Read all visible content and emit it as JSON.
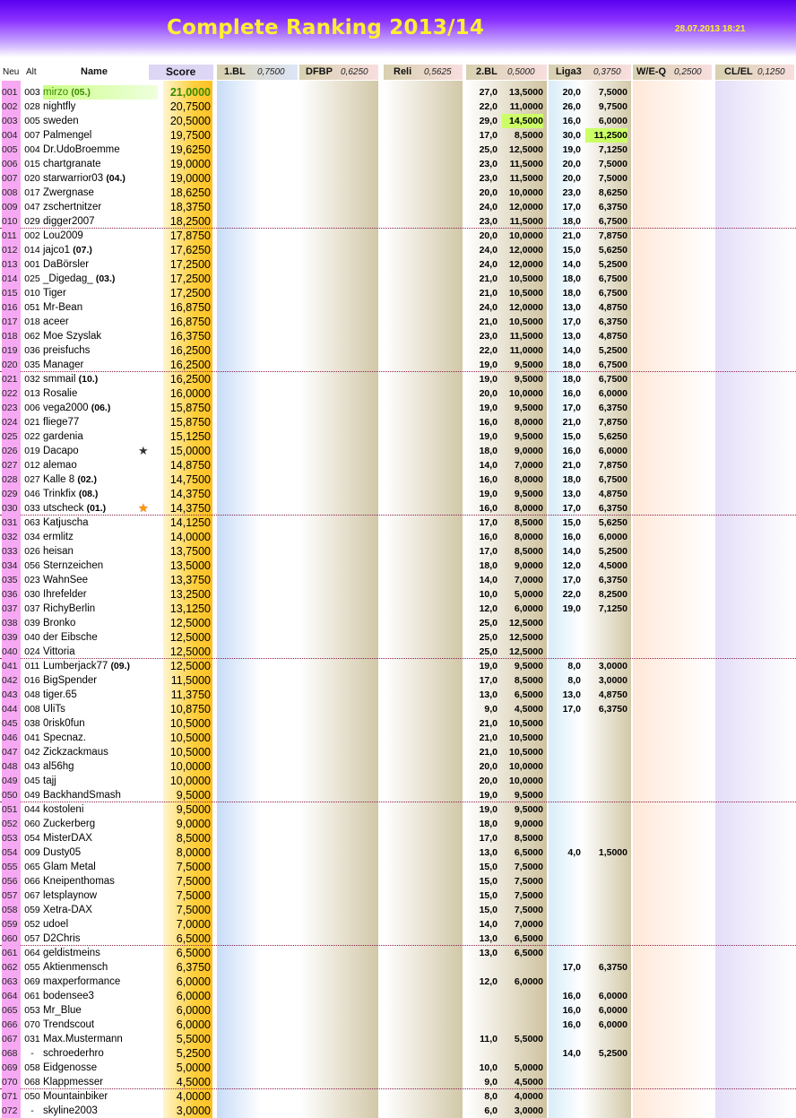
{
  "header": {
    "title": "Complete Ranking 2013/14",
    "timestamp": "28.07.2013 18:21"
  },
  "columns": {
    "neu": "Neu",
    "alt": "Alt",
    "name": "Name",
    "score": "Score",
    "comps": [
      {
        "label": "1.BL",
        "weight": "0,7500",
        "bg": "#dde6f8"
      },
      {
        "label": "DFBP",
        "weight": "0,6250",
        "bg": "#f8dede"
      },
      {
        "label": "Reli",
        "weight": "0,5625",
        "bg": "#f8dede"
      },
      {
        "label": "2.BL",
        "weight": "0,5000",
        "bg": "#f8dede"
      },
      {
        "label": "Liga3",
        "weight": "0,3750",
        "bg": "#f8dede"
      },
      {
        "label": "W/E-Q",
        "weight": "0,2500",
        "bg": "#f8dede"
      },
      {
        "label": "CL/EL",
        "weight": "0,1250",
        "bg": "#f8dede"
      }
    ]
  },
  "colors": {
    "neu": "#f6a8f2",
    "score": "#ffcc33",
    "highlight": "#ccff66",
    "title": "#ffee33",
    "banner": "#6a10f8"
  },
  "rows": [
    {
      "neu": "001",
      "alt": "003",
      "name": "mirzo",
      "badge": "(05.)",
      "score": "21,0000",
      "b2t": "27,0",
      "b2s": "13,5000",
      "l3t": "20,0",
      "l3s": "7,5000",
      "top": true
    },
    {
      "neu": "002",
      "alt": "028",
      "name": "nightfly",
      "badge": "",
      "score": "20,7500",
      "b2t": "22,0",
      "b2s": "11,0000",
      "l3t": "26,0",
      "l3s": "9,7500"
    },
    {
      "neu": "003",
      "alt": "005",
      "name": "sweden",
      "badge": "",
      "score": "20,5000",
      "b2t": "29,0",
      "b2s": "14,5000",
      "l3t": "16,0",
      "l3s": "6,0000",
      "hl2": true
    },
    {
      "neu": "004",
      "alt": "007",
      "name": "Palmengel",
      "badge": "",
      "score": "19,7500",
      "b2t": "17,0",
      "b2s": "8,5000",
      "l3t": "30,0",
      "l3s": "11,2500",
      "hl3": true
    },
    {
      "neu": "005",
      "alt": "004",
      "name": "Dr.UdoBroemme",
      "badge": "",
      "score": "19,6250",
      "b2t": "25,0",
      "b2s": "12,5000",
      "l3t": "19,0",
      "l3s": "7,1250"
    },
    {
      "neu": "006",
      "alt": "015",
      "name": "chartgranate",
      "badge": "",
      "score": "19,0000",
      "b2t": "23,0",
      "b2s": "11,5000",
      "l3t": "20,0",
      "l3s": "7,5000"
    },
    {
      "neu": "007",
      "alt": "020",
      "name": "starwarrior03",
      "badge": "(04.)",
      "score": "19,0000",
      "b2t": "23,0",
      "b2s": "11,5000",
      "l3t": "20,0",
      "l3s": "7,5000"
    },
    {
      "neu": "008",
      "alt": "017",
      "name": "Zwergnase",
      "badge": "",
      "score": "18,6250",
      "b2t": "20,0",
      "b2s": "10,0000",
      "l3t": "23,0",
      "l3s": "8,6250"
    },
    {
      "neu": "009",
      "alt": "047",
      "name": "zschertnitzer",
      "badge": "",
      "score": "18,3750",
      "b2t": "24,0",
      "b2s": "12,0000",
      "l3t": "17,0",
      "l3s": "6,3750"
    },
    {
      "neu": "010",
      "alt": "029",
      "name": "digger2007",
      "badge": "",
      "score": "18,2500",
      "b2t": "23,0",
      "b2s": "11,5000",
      "l3t": "18,0",
      "l3s": "6,7500"
    },
    {
      "neu": "011",
      "alt": "002",
      "name": "Lou2009",
      "badge": "",
      "score": "17,8750",
      "b2t": "20,0",
      "b2s": "10,0000",
      "l3t": "21,0",
      "l3s": "7,8750"
    },
    {
      "neu": "012",
      "alt": "014",
      "name": "jajco1",
      "badge": "(07.)",
      "score": "17,6250",
      "b2t": "24,0",
      "b2s": "12,0000",
      "l3t": "15,0",
      "l3s": "5,6250"
    },
    {
      "neu": "013",
      "alt": "001",
      "name": "DaBörsler",
      "badge": "",
      "score": "17,2500",
      "b2t": "24,0",
      "b2s": "12,0000",
      "l3t": "14,0",
      "l3s": "5,2500"
    },
    {
      "neu": "014",
      "alt": "025",
      "name": "_Digedag_",
      "badge": "(03.)",
      "score": "17,2500",
      "b2t": "21,0",
      "b2s": "10,5000",
      "l3t": "18,0",
      "l3s": "6,7500"
    },
    {
      "neu": "015",
      "alt": "010",
      "name": "Tiger",
      "badge": "",
      "score": "17,2500",
      "b2t": "21,0",
      "b2s": "10,5000",
      "l3t": "18,0",
      "l3s": "6,7500"
    },
    {
      "neu": "016",
      "alt": "051",
      "name": "Mr-Bean",
      "badge": "",
      "score": "16,8750",
      "b2t": "24,0",
      "b2s": "12,0000",
      "l3t": "13,0",
      "l3s": "4,8750"
    },
    {
      "neu": "017",
      "alt": "018",
      "name": "aceer",
      "badge": "",
      "score": "16,8750",
      "b2t": "21,0",
      "b2s": "10,5000",
      "l3t": "17,0",
      "l3s": "6,3750"
    },
    {
      "neu": "018",
      "alt": "062",
      "name": "Moe Szyslak",
      "badge": "",
      "score": "16,3750",
      "b2t": "23,0",
      "b2s": "11,5000",
      "l3t": "13,0",
      "l3s": "4,8750"
    },
    {
      "neu": "019",
      "alt": "036",
      "name": "preisfuchs",
      "badge": "",
      "score": "16,2500",
      "b2t": "22,0",
      "b2s": "11,0000",
      "l3t": "14,0",
      "l3s": "5,2500"
    },
    {
      "neu": "020",
      "alt": "035",
      "name": "Manager",
      "badge": "",
      "score": "16,2500",
      "b2t": "19,0",
      "b2s": "9,5000",
      "l3t": "18,0",
      "l3s": "6,7500"
    },
    {
      "neu": "021",
      "alt": "032",
      "name": "smmail",
      "badge": "(10.)",
      "score": "16,2500",
      "b2t": "19,0",
      "b2s": "9,5000",
      "l3t": "18,0",
      "l3s": "6,7500"
    },
    {
      "neu": "022",
      "alt": "013",
      "name": "Rosalie",
      "badge": "",
      "score": "16,0000",
      "b2t": "20,0",
      "b2s": "10,0000",
      "l3t": "16,0",
      "l3s": "6,0000"
    },
    {
      "neu": "023",
      "alt": "006",
      "name": "vega2000",
      "badge": "(06.)",
      "score": "15,8750",
      "b2t": "19,0",
      "b2s": "9,5000",
      "l3t": "17,0",
      "l3s": "6,3750"
    },
    {
      "neu": "024",
      "alt": "021",
      "name": "fliege77",
      "badge": "",
      "score": "15,8750",
      "b2t": "16,0",
      "b2s": "8,0000",
      "l3t": "21,0",
      "l3s": "7,8750"
    },
    {
      "neu": "025",
      "alt": "022",
      "name": "gardenia",
      "badge": "",
      "score": "15,1250",
      "b2t": "19,0",
      "b2s": "9,5000",
      "l3t": "15,0",
      "l3s": "5,6250"
    },
    {
      "neu": "026",
      "alt": "019",
      "name": "Dacapo",
      "badge": "",
      "score": "15,0000",
      "b2t": "18,0",
      "b2s": "9,0000",
      "l3t": "16,0",
      "l3s": "6,0000",
      "star": "dark"
    },
    {
      "neu": "027",
      "alt": "012",
      "name": "alemao",
      "badge": "",
      "score": "14,8750",
      "b2t": "14,0",
      "b2s": "7,0000",
      "l3t": "21,0",
      "l3s": "7,8750"
    },
    {
      "neu": "028",
      "alt": "027",
      "name": "Kalle 8",
      "badge": "(02.)",
      "score": "14,7500",
      "b2t": "16,0",
      "b2s": "8,0000",
      "l3t": "18,0",
      "l3s": "6,7500"
    },
    {
      "neu": "029",
      "alt": "046",
      "name": "Trinkfix",
      "badge": "(08.)",
      "score": "14,3750",
      "b2t": "19,0",
      "b2s": "9,5000",
      "l3t": "13,0",
      "l3s": "4,8750"
    },
    {
      "neu": "030",
      "alt": "033",
      "name": "utscheck",
      "badge": "(01.)",
      "score": "14,3750",
      "b2t": "16,0",
      "b2s": "8,0000",
      "l3t": "17,0",
      "l3s": "6,3750",
      "star": "gold"
    },
    {
      "neu": "031",
      "alt": "063",
      "name": "Katjuscha",
      "badge": "",
      "score": "14,1250",
      "b2t": "17,0",
      "b2s": "8,5000",
      "l3t": "15,0",
      "l3s": "5,6250"
    },
    {
      "neu": "032",
      "alt": "034",
      "name": "ermlitz",
      "badge": "",
      "score": "14,0000",
      "b2t": "16,0",
      "b2s": "8,0000",
      "l3t": "16,0",
      "l3s": "6,0000"
    },
    {
      "neu": "033",
      "alt": "026",
      "name": "heisan",
      "badge": "",
      "score": "13,7500",
      "b2t": "17,0",
      "b2s": "8,5000",
      "l3t": "14,0",
      "l3s": "5,2500"
    },
    {
      "neu": "034",
      "alt": "056",
      "name": "Sternzeichen",
      "badge": "",
      "score": "13,5000",
      "b2t": "18,0",
      "b2s": "9,0000",
      "l3t": "12,0",
      "l3s": "4,5000"
    },
    {
      "neu": "035",
      "alt": "023",
      "name": "WahnSee",
      "badge": "",
      "score": "13,3750",
      "b2t": "14,0",
      "b2s": "7,0000",
      "l3t": "17,0",
      "l3s": "6,3750"
    },
    {
      "neu": "036",
      "alt": "030",
      "name": "Ihrefelder",
      "badge": "",
      "score": "13,2500",
      "b2t": "10,0",
      "b2s": "5,0000",
      "l3t": "22,0",
      "l3s": "8,2500"
    },
    {
      "neu": "037",
      "alt": "037",
      "name": "RichyBerlin",
      "badge": "",
      "score": "13,1250",
      "b2t": "12,0",
      "b2s": "6,0000",
      "l3t": "19,0",
      "l3s": "7,1250"
    },
    {
      "neu": "038",
      "alt": "039",
      "name": "Bronko",
      "badge": "",
      "score": "12,5000",
      "b2t": "25,0",
      "b2s": "12,5000",
      "l3t": "",
      "l3s": ""
    },
    {
      "neu": "039",
      "alt": "040",
      "name": "der Eibsche",
      "badge": "",
      "score": "12,5000",
      "b2t": "25,0",
      "b2s": "12,5000",
      "l3t": "",
      "l3s": ""
    },
    {
      "neu": "040",
      "alt": "024",
      "name": "Vittoria",
      "badge": "",
      "score": "12,5000",
      "b2t": "25,0",
      "b2s": "12,5000",
      "l3t": "",
      "l3s": ""
    },
    {
      "neu": "041",
      "alt": "011",
      "name": "Lumberjack77",
      "badge": "(09.)",
      "score": "12,5000",
      "b2t": "19,0",
      "b2s": "9,5000",
      "l3t": "8,0",
      "l3s": "3,0000"
    },
    {
      "neu": "042",
      "alt": "016",
      "name": "BigSpender",
      "badge": "",
      "score": "11,5000",
      "b2t": "17,0",
      "b2s": "8,5000",
      "l3t": "8,0",
      "l3s": "3,0000"
    },
    {
      "neu": "043",
      "alt": "048",
      "name": "tiger.65",
      "badge": "",
      "score": "11,3750",
      "b2t": "13,0",
      "b2s": "6,5000",
      "l3t": "13,0",
      "l3s": "4,8750"
    },
    {
      "neu": "044",
      "alt": "008",
      "name": "UliTs",
      "badge": "",
      "score": "10,8750",
      "b2t": "9,0",
      "b2s": "4,5000",
      "l3t": "17,0",
      "l3s": "6,3750"
    },
    {
      "neu": "045",
      "alt": "038",
      "name": "0risk0fun",
      "badge": "",
      "score": "10,5000",
      "b2t": "21,0",
      "b2s": "10,5000",
      "l3t": "",
      "l3s": ""
    },
    {
      "neu": "046",
      "alt": "041",
      "name": "Specnaz.",
      "badge": "",
      "score": "10,5000",
      "b2t": "21,0",
      "b2s": "10,5000",
      "l3t": "",
      "l3s": ""
    },
    {
      "neu": "047",
      "alt": "042",
      "name": "Zickzackmaus",
      "badge": "",
      "score": "10,5000",
      "b2t": "21,0",
      "b2s": "10,5000",
      "l3t": "",
      "l3s": ""
    },
    {
      "neu": "048",
      "alt": "043",
      "name": "al56hg",
      "badge": "",
      "score": "10,0000",
      "b2t": "20,0",
      "b2s": "10,0000",
      "l3t": "",
      "l3s": ""
    },
    {
      "neu": "049",
      "alt": "045",
      "name": "tajj",
      "badge": "",
      "score": "10,0000",
      "b2t": "20,0",
      "b2s": "10,0000",
      "l3t": "",
      "l3s": ""
    },
    {
      "neu": "050",
      "alt": "049",
      "name": "BackhandSmash",
      "badge": "",
      "score": "9,5000",
      "b2t": "19,0",
      "b2s": "9,5000",
      "l3t": "",
      "l3s": ""
    },
    {
      "neu": "051",
      "alt": "044",
      "name": "kostoleni",
      "badge": "",
      "score": "9,5000",
      "b2t": "19,0",
      "b2s": "9,5000",
      "l3t": "",
      "l3s": ""
    },
    {
      "neu": "052",
      "alt": "060",
      "name": "Zuckerberg",
      "badge": "",
      "score": "9,0000",
      "b2t": "18,0",
      "b2s": "9,0000",
      "l3t": "",
      "l3s": ""
    },
    {
      "neu": "053",
      "alt": "054",
      "name": "MisterDAX",
      "badge": "",
      "score": "8,5000",
      "b2t": "17,0",
      "b2s": "8,5000",
      "l3t": "",
      "l3s": ""
    },
    {
      "neu": "054",
      "alt": "009",
      "name": "Dusty05",
      "badge": "",
      "score": "8,0000",
      "b2t": "13,0",
      "b2s": "6,5000",
      "l3t": "4,0",
      "l3s": "1,5000"
    },
    {
      "neu": "055",
      "alt": "065",
      "name": "Glam Metal",
      "badge": "",
      "score": "7,5000",
      "b2t": "15,0",
      "b2s": "7,5000",
      "l3t": "",
      "l3s": ""
    },
    {
      "neu": "056",
      "alt": "066",
      "name": "Kneipenthomas",
      "badge": "",
      "score": "7,5000",
      "b2t": "15,0",
      "b2s": "7,5000",
      "l3t": "",
      "l3s": ""
    },
    {
      "neu": "057",
      "alt": "067",
      "name": "letsplaynow",
      "badge": "",
      "score": "7,5000",
      "b2t": "15,0",
      "b2s": "7,5000",
      "l3t": "",
      "l3s": ""
    },
    {
      "neu": "058",
      "alt": "059",
      "name": "Xetra-DAX",
      "badge": "",
      "score": "7,5000",
      "b2t": "15,0",
      "b2s": "7,5000",
      "l3t": "",
      "l3s": ""
    },
    {
      "neu": "059",
      "alt": "052",
      "name": "udoel",
      "badge": "",
      "score": "7,0000",
      "b2t": "14,0",
      "b2s": "7,0000",
      "l3t": "",
      "l3s": ""
    },
    {
      "neu": "060",
      "alt": "057",
      "name": "D2Chris",
      "badge": "",
      "score": "6,5000",
      "b2t": "13,0",
      "b2s": "6,5000",
      "l3t": "",
      "l3s": ""
    },
    {
      "neu": "061",
      "alt": "064",
      "name": "geldistmeins",
      "badge": "",
      "score": "6,5000",
      "b2t": "13,0",
      "b2s": "6,5000",
      "l3t": "",
      "l3s": ""
    },
    {
      "neu": "062",
      "alt": "055",
      "name": "Aktienmensch",
      "badge": "",
      "score": "6,3750",
      "b2t": "",
      "b2s": "",
      "l3t": "17,0",
      "l3s": "6,3750"
    },
    {
      "neu": "063",
      "alt": "069",
      "name": "maxperformance",
      "badge": "",
      "score": "6,0000",
      "b2t": "12,0",
      "b2s": "6,0000",
      "l3t": "",
      "l3s": ""
    },
    {
      "neu": "064",
      "alt": "061",
      "name": "bodensee3",
      "badge": "",
      "score": "6,0000",
      "b2t": "",
      "b2s": "",
      "l3t": "16,0",
      "l3s": "6,0000"
    },
    {
      "neu": "065",
      "alt": "053",
      "name": "Mr_Blue",
      "badge": "",
      "score": "6,0000",
      "b2t": "",
      "b2s": "",
      "l3t": "16,0",
      "l3s": "6,0000"
    },
    {
      "neu": "066",
      "alt": "070",
      "name": "Trendscout",
      "badge": "",
      "score": "6,0000",
      "b2t": "",
      "b2s": "",
      "l3t": "16,0",
      "l3s": "6,0000"
    },
    {
      "neu": "067",
      "alt": "031",
      "name": "Max.Mustermann",
      "badge": "",
      "score": "5,5000",
      "b2t": "11,0",
      "b2s": "5,5000",
      "l3t": "",
      "l3s": ""
    },
    {
      "neu": "068",
      "alt": "-",
      "name": "schroederhro",
      "badge": "",
      "score": "5,2500",
      "b2t": "",
      "b2s": "",
      "l3t": "14,0",
      "l3s": "5,2500"
    },
    {
      "neu": "069",
      "alt": "058",
      "name": "Eidgenosse",
      "badge": "",
      "score": "5,0000",
      "b2t": "10,0",
      "b2s": "5,0000",
      "l3t": "",
      "l3s": ""
    },
    {
      "neu": "070",
      "alt": "068",
      "name": "Klappmesser",
      "badge": "",
      "score": "4,5000",
      "b2t": "9,0",
      "b2s": "4,5000",
      "l3t": "",
      "l3s": ""
    },
    {
      "neu": "071",
      "alt": "050",
      "name": "Mountainbiker",
      "badge": "",
      "score": "4,0000",
      "b2t": "8,0",
      "b2s": "4,0000",
      "l3t": "",
      "l3s": ""
    },
    {
      "neu": "072",
      "alt": "-",
      "name": "skyline2003",
      "badge": "",
      "score": "3,0000",
      "b2t": "6,0",
      "b2s": "3,0000",
      "l3t": "",
      "l3s": ""
    }
  ]
}
